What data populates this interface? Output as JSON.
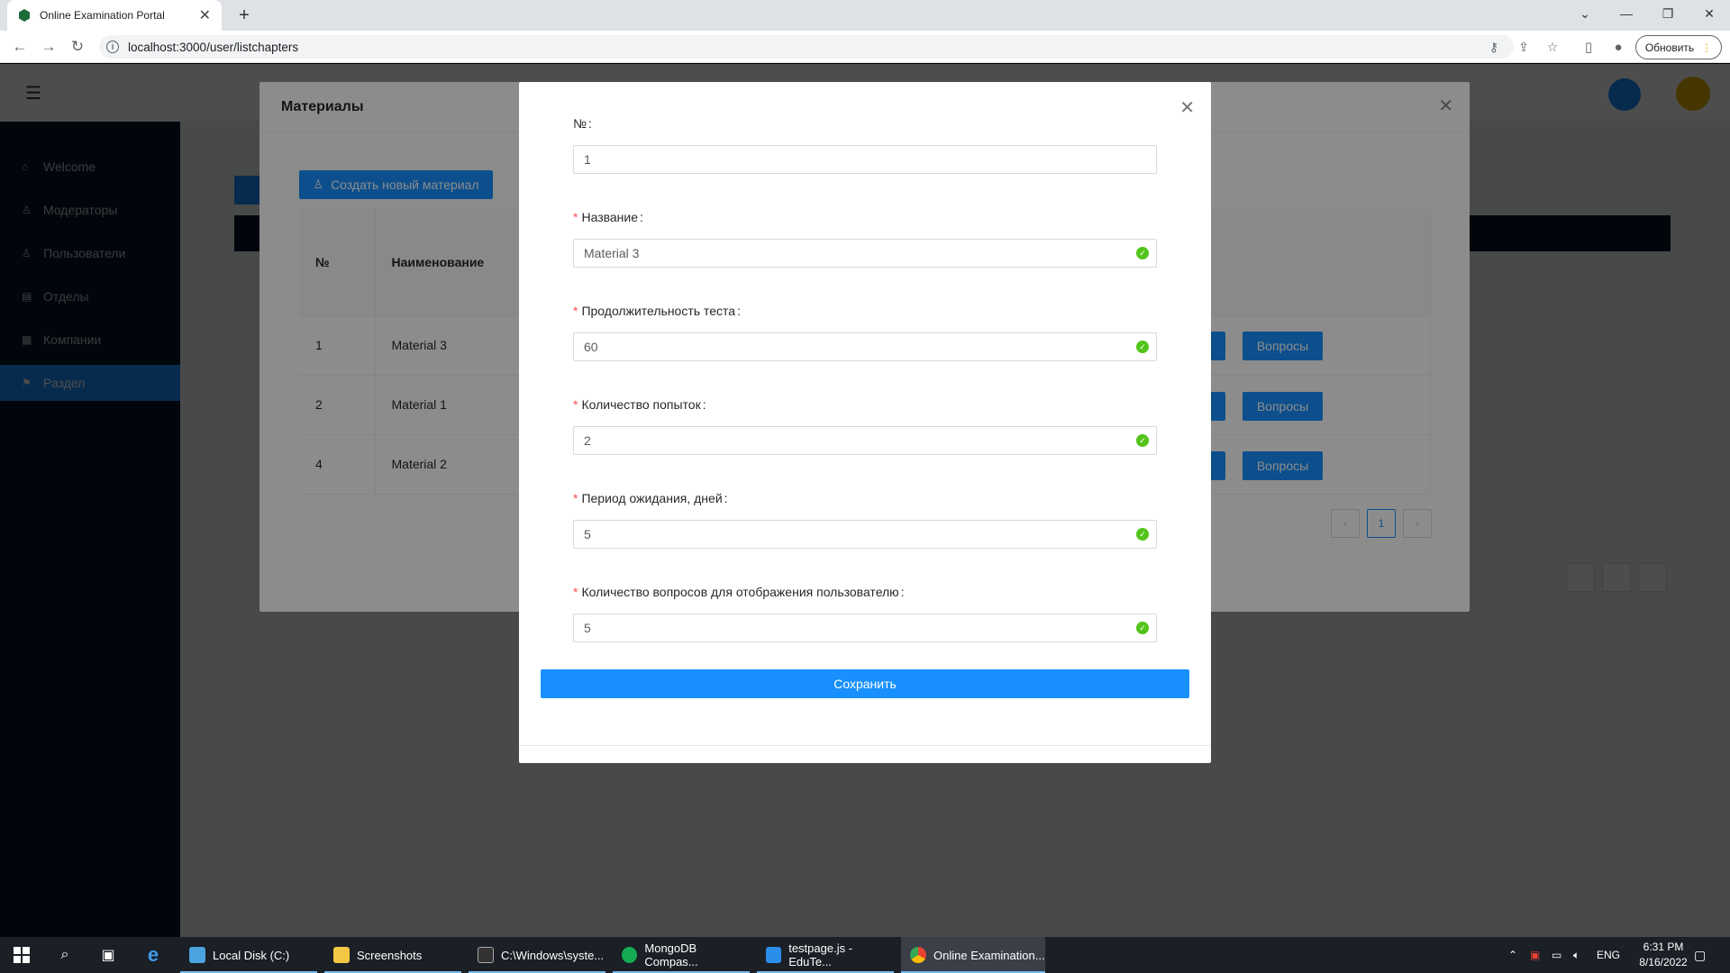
{
  "browser": {
    "tab_title": "Online Examination Portal",
    "url": "localhost:3000/user/listchapters",
    "update_label": "Обновить"
  },
  "sidebar": {
    "items": [
      {
        "label": "Welcome",
        "icon": "home-icon"
      },
      {
        "label": "Модераторы",
        "icon": "user-icon"
      },
      {
        "label": "Пользователи",
        "icon": "user-icon"
      },
      {
        "label": "Отделы",
        "icon": "document-icon"
      },
      {
        "label": "Компании",
        "icon": "building-icon"
      },
      {
        "label": "Раздел",
        "icon": "flag-icon"
      }
    ]
  },
  "materials_modal": {
    "title": "Материалы",
    "create_label": "Создать новый материал",
    "columns": [
      "№",
      "Наименование"
    ],
    "rows": [
      {
        "num": "1",
        "name": "Material 3"
      },
      {
        "num": "2",
        "name": "Material 1"
      },
      {
        "num": "4",
        "name": "Material 2"
      }
    ],
    "questions_label": "Вопросы",
    "page": "1"
  },
  "edit_form": {
    "fields": [
      {
        "label": "№",
        "required": false,
        "value": "1",
        "valid": false
      },
      {
        "label": "Название",
        "required": true,
        "value": "Material 3",
        "valid": true
      },
      {
        "label": "Продолжительность теста",
        "required": true,
        "value": "60",
        "valid": true
      },
      {
        "label": "Количество попыток",
        "required": true,
        "value": "2",
        "valid": true
      },
      {
        "label": "Период ожидания, дней",
        "required": true,
        "value": "5",
        "valid": true
      },
      {
        "label": "Количество вопросов для отображения пользователю",
        "required": true,
        "value": "5",
        "valid": true
      }
    ],
    "colon": ":",
    "required_mark": "*",
    "save_label": "Сохранить"
  },
  "taskbar": {
    "apps": [
      {
        "label": "Local Disk (C:)",
        "color": "#4aa3df"
      },
      {
        "label": "Screenshots",
        "color": "#f2c744"
      },
      {
        "label": "C:\\Windows\\syste...",
        "color": "#333333"
      },
      {
        "label": "MongoDB Compas...",
        "color": "#13aa52"
      },
      {
        "label": "testpage.js - EduTe...",
        "color": "#2b8ee8"
      },
      {
        "label": "Online Examination...",
        "color": "#e94235"
      }
    ],
    "lang": "ENG",
    "time": "6:31 PM",
    "date": "8/16/2022"
  },
  "colors": {
    "primary": "#1890ff",
    "success": "#52c41a",
    "required": "#ff4d4f"
  }
}
